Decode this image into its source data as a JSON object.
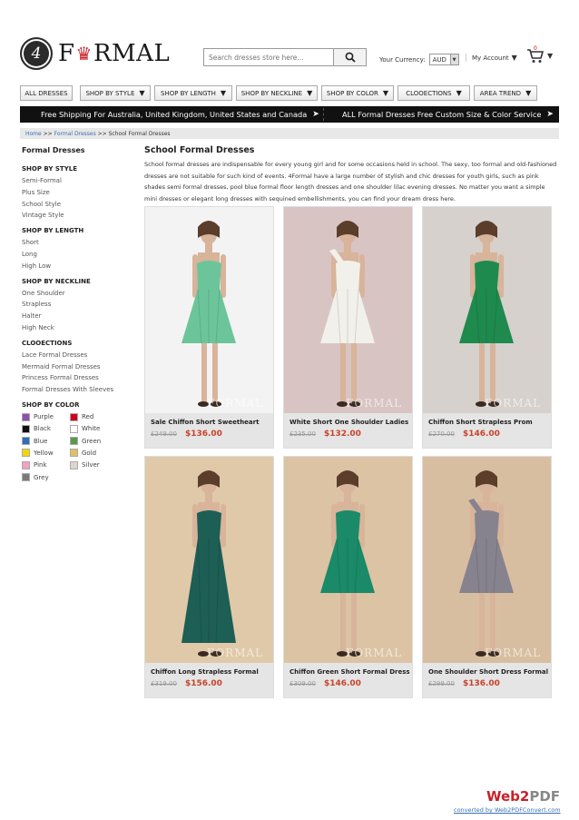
{
  "header": {
    "logo_badge": "4",
    "logo_word_pre": "F",
    "logo_word_post": "RMAL",
    "search_placeholder": "Search dresses store here...",
    "currency_label": "Your Currency:",
    "currency_value": "AUD",
    "account_label": "My Account",
    "cart_count": "0"
  },
  "nav": [
    {
      "label": "ALL DRESSES",
      "arrow": ""
    },
    {
      "label": "SHOP BY STYLE",
      "arrow": "▼"
    },
    {
      "label": "SHOP BY LENGTH",
      "arrow": "▼"
    },
    {
      "label": "SHOP BY NECKLINE",
      "arrow": "▼"
    },
    {
      "label": "SHOP BY COLOR",
      "arrow": "▼"
    },
    {
      "label": "CLOOECTIONS",
      "arrow": "▼"
    },
    {
      "label": "AREA TREND",
      "arrow": "▼"
    }
  ],
  "promo": {
    "left": "Free Shipping For Australia, United Kingdom, United States and Canada",
    "right": "ALL Formal Dresses Free Custom Size & Color Service"
  },
  "breadcrumb": {
    "home": "Home",
    "sep1": ">>",
    "formal": "Formal Dresses",
    "sep2": ">>",
    "current": "School Formal Dresses"
  },
  "sidebar": {
    "title": "Formal Dresses",
    "style_head": "SHOP BY STYLE",
    "style_items": [
      "Semi-Formal",
      "Plus Size",
      "School Style",
      "Vintage Style"
    ],
    "length_head": "SHOP BY LENGTH",
    "length_items": [
      "Short",
      "Long",
      "High Low"
    ],
    "neckline_head": "SHOP BY NECKLINE",
    "neckline_items": [
      "One Shoulder",
      "Strapless",
      "Halter",
      "High Neck"
    ],
    "collections_head": "CLOOECTIONS",
    "collections_items": [
      "Lace Formal Dresses",
      "Mermaid Formal Dresses",
      "Princess Formal Dresses",
      "Formal Dresses With Sleeves"
    ],
    "color_head": "SHOP BY COLOR",
    "colors": [
      {
        "name": "Purple",
        "hex": "#8e4fb0"
      },
      {
        "name": "Red",
        "hex": "#d0021b"
      },
      {
        "name": "Black",
        "hex": "#111111"
      },
      {
        "name": "White",
        "hex": "#ffffff"
      },
      {
        "name": "Blue",
        "hex": "#2d6fb8"
      },
      {
        "name": "Green",
        "hex": "#5a9a4a"
      },
      {
        "name": "Yellow",
        "hex": "#f5d400"
      },
      {
        "name": "Gold",
        "hex": "#e0c060"
      },
      {
        "name": "Pink",
        "hex": "#f4a0c0"
      },
      {
        "name": "Silver",
        "hex": "#dcd6cc"
      },
      {
        "name": "Grey",
        "hex": "#7a7a7a"
      }
    ]
  },
  "main": {
    "title": "School Formal Dresses",
    "description": "School formal dresses are indispensable for every young girl and for some occasions held in school. The sexy, too formal and old-fashioned dresses are not suitable for such kind of events. 4Formal have a large number of stylish and chic dresses for youth girls, such as pink shades semi formal dresses, pool blue formal floor length dresses and one shoulder lilac evening dresses. No matter you want a simple mini dresses or elegant long dresses with sequined embellishments, you can find your dream dress here."
  },
  "products": [
    {
      "name": "Sale Chiffon Short Sweetheart",
      "old_price": "£249.00",
      "price": "$136.00",
      "dress_color": "#6cc59a",
      "bg": "#f4f3f4",
      "length": "short",
      "strap": "none"
    },
    {
      "name": "White Short One Shoulder Ladies",
      "old_price": "£235.00",
      "price": "$132.00",
      "dress_color": "#f2f0ea",
      "bg": "#d9c4c4",
      "length": "short",
      "strap": "one"
    },
    {
      "name": "Chiffon Short Strapless Prom",
      "old_price": "£270.00",
      "price": "$146.00",
      "dress_color": "#1f8a4e",
      "bg": "#d6d1cc",
      "length": "short",
      "strap": "none"
    },
    {
      "name": "Chiffon Long Strapless Formal",
      "old_price": "£319.00",
      "price": "$156.00",
      "dress_color": "#1d5e55",
      "bg": "#e0c9a9",
      "length": "long",
      "strap": "none"
    },
    {
      "name": "Chiffon Green Short Formal Dress",
      "old_price": "£309.00",
      "price": "$146.00",
      "dress_color": "#1a8a68",
      "bg": "#dbc3a4",
      "length": "short",
      "strap": "none"
    },
    {
      "name": "One Shoulder Short Dress Formal",
      "old_price": "£299.00",
      "price": "$136.00",
      "dress_color": "#86838f",
      "bg": "#d8bea0",
      "length": "short",
      "strap": "one"
    }
  ],
  "watermark": "FORMAL",
  "footer": {
    "logo_pre": "Web2",
    "logo_post": "PDF",
    "link": "converted by Web2PDFConvert.com"
  }
}
